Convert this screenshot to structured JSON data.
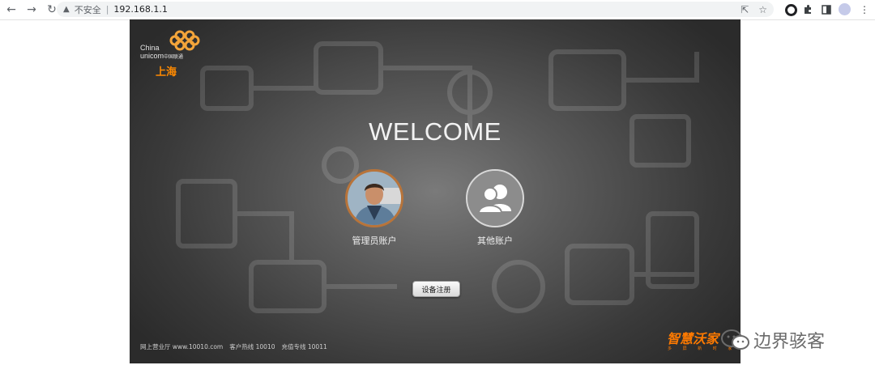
{
  "browser": {
    "security_label": "不安全",
    "separator": "|",
    "url": "192.168.1.1"
  },
  "logo": {
    "brand_line1": "China",
    "brand_line2": "unicom",
    "brand_cn": "中国联通",
    "city": "上海"
  },
  "welcome": "WELCOME",
  "accounts": [
    {
      "label": "管理员账户"
    },
    {
      "label": "其他账户"
    }
  ],
  "register_button": "设备注册",
  "footer": {
    "hall": "网上营业厅 www.10010.com",
    "hotline": "客户热线 10010",
    "recharge": "充值专线 10011"
  },
  "brand": {
    "name": "智慧沃家",
    "tagline": "多 屏 新 时 家"
  },
  "watermark": "边界骇客",
  "colors": {
    "accent_orange": "#ff7a00",
    "panel_dark": "#2b2b2b"
  }
}
